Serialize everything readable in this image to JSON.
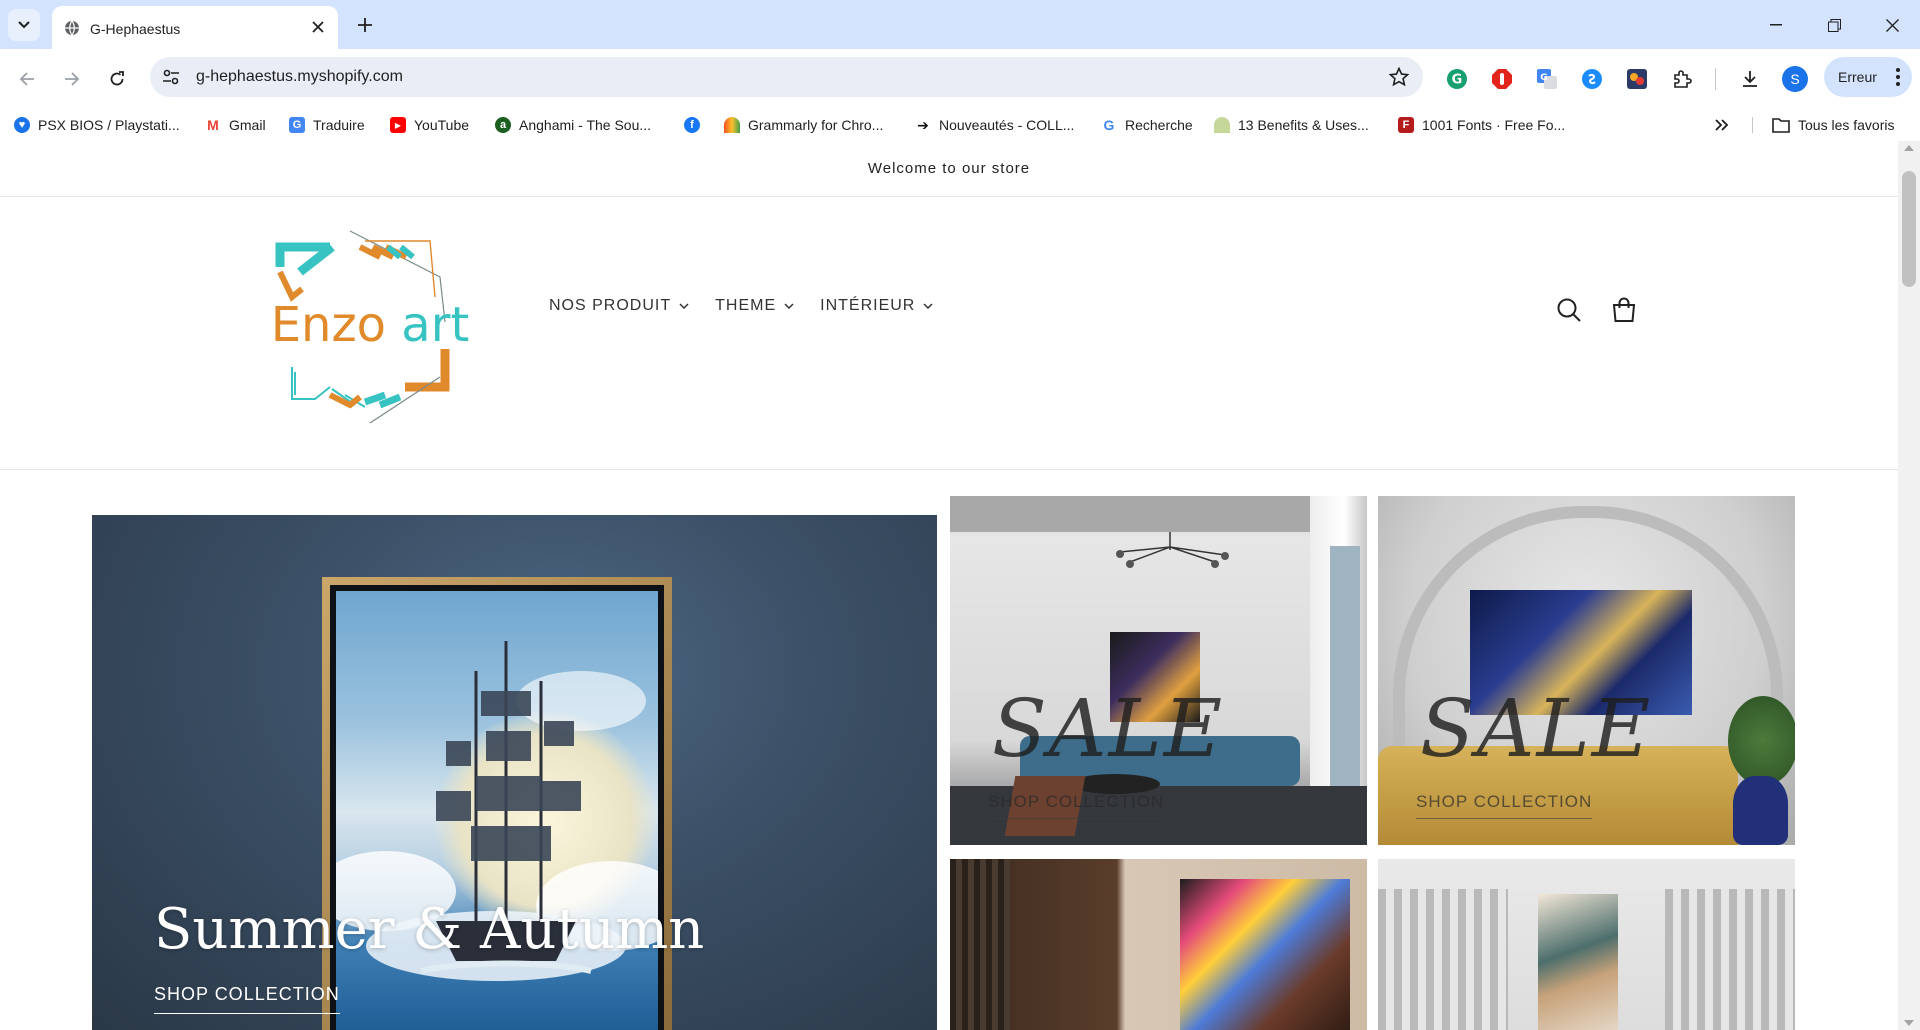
{
  "browser": {
    "tab_title": "G-Hephaestus",
    "url": "g-hephaestus.myshopify.com",
    "profile_initial": "S",
    "error_label": "Erreur",
    "bookmarks": [
      {
        "label": "PSX BIOS / Playstati...",
        "icon": "heart-icon",
        "color": "#1a73e8"
      },
      {
        "label": "Gmail",
        "icon": "gmail-icon",
        "color": "#ea4335"
      },
      {
        "label": "Traduire",
        "icon": "translate-icon",
        "color": "#4285f4"
      },
      {
        "label": "YouTube",
        "icon": "youtube-icon",
        "color": "#ff0000"
      },
      {
        "label": "Anghami - The Sou...",
        "icon": "anghami-icon",
        "color": "#1b5e20"
      },
      {
        "label": "",
        "icon": "facebook-icon",
        "color": "#1877f2"
      },
      {
        "label": "Grammarly for Chro...",
        "icon": "grammarly-icon",
        "color": "#f4511e"
      },
      {
        "label": "Nouveautés - COLL...",
        "icon": "collection-icon",
        "color": "#111111"
      },
      {
        "label": "Recherche",
        "icon": "google-icon",
        "color": "#4285f4"
      },
      {
        "label": "13 Benefits & Uses...",
        "icon": "leaf-icon",
        "color": "#c5d89a"
      },
      {
        "label": "1001 Fonts · Free Fo...",
        "icon": "fonts-icon",
        "color": "#b71c1c"
      }
    ],
    "all_bookmarks_label": "Tous les favoris"
  },
  "store": {
    "announcement": "Welcome to our store",
    "logo_text": "Enzo art",
    "menu": [
      "NOS PRODUIT",
      "THEME",
      "INTÉRIEUR"
    ],
    "hero": {
      "title": "Summer & Autumn",
      "cta": "SHOP COLLECTION"
    },
    "tiles": [
      {
        "overlay": "SALE",
        "cta": "SHOP COLLECTION"
      },
      {
        "overlay": "SALE",
        "cta": "SHOP COLLECTION"
      },
      {
        "overlay": "",
        "cta": ""
      },
      {
        "overlay": "",
        "cta": ""
      }
    ]
  },
  "colors": {
    "logo_orange": "#e08a2b",
    "logo_teal": "#38c3c3",
    "chrome_blue": "#d3e3fd"
  }
}
